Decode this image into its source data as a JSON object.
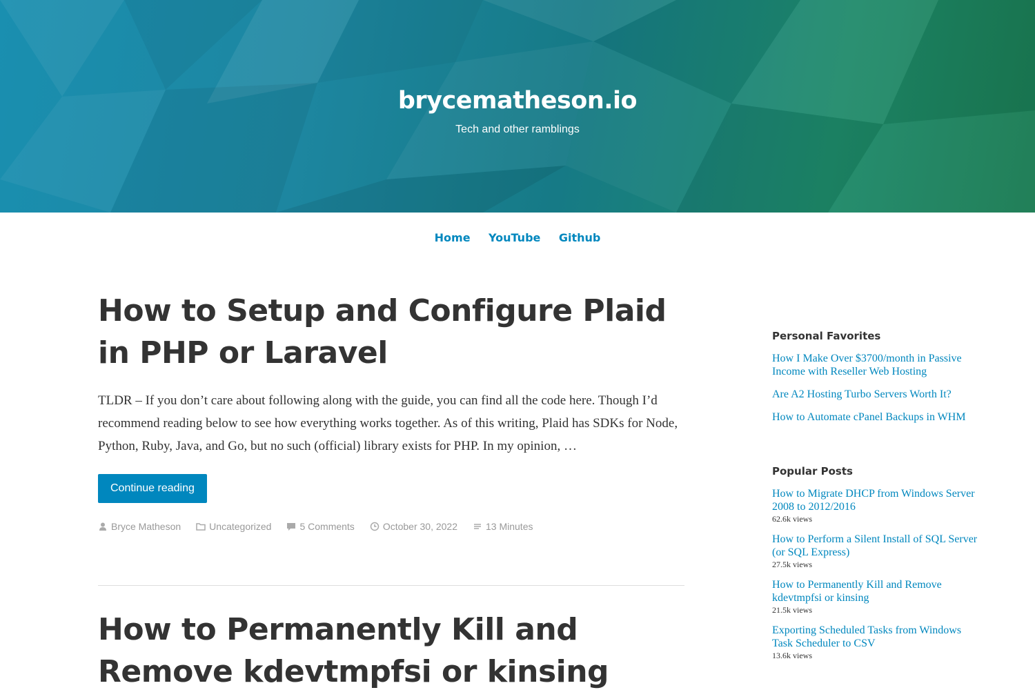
{
  "header": {
    "site_title": "brycematheson.io",
    "tagline": "Tech and other ramblings"
  },
  "nav": {
    "items": [
      "Home",
      "YouTube",
      "Github"
    ]
  },
  "posts": [
    {
      "title": "How to Setup and Configure Plaid in PHP or Laravel",
      "excerpt": "TLDR – If you don’t care about following along with the guide, you can find all the code here. Though I’d recommend reading below to see how everything works together. As of this writing, Plaid has SDKs for Node, Python, Ruby, Java, and Go, but no such (official) library exists for PHP. In my opinion, …",
      "button": "Continue reading",
      "author": "Bryce Matheson",
      "category": "Uncategorized",
      "comments": "5 Comments",
      "date": "October 30, 2022",
      "read_time": "13 Minutes"
    },
    {
      "title": "How to Permanently Kill and Remove kdevtmpfsi or kinsing"
    }
  ],
  "sidebar": {
    "favorites_title": "Personal Favorites",
    "favorites": [
      "How I Make Over $3700/month in Passive Income with Reseller Web Hosting",
      "Are A2 Hosting Turbo Servers Worth It?",
      "How to Automate cPanel Backups in WHM"
    ],
    "popular_title": "Popular Posts",
    "popular": [
      {
        "title": "How to Migrate DHCP from Windows Server 2008 to 2012/2016",
        "views": "62.6k views"
      },
      {
        "title": "How to Perform a Silent Install of SQL Server (or SQL Express)",
        "views": "27.5k views"
      },
      {
        "title": "How to Permanently Kill and Remove kdevtmpfsi or kinsing",
        "views": "21.5k views"
      },
      {
        "title": "Exporting Scheduled Tasks from Windows Task Scheduler to CSV",
        "views": "13.6k views"
      }
    ]
  },
  "colors": {
    "link": "#0087be",
    "text": "#333333",
    "meta": "#999999"
  }
}
